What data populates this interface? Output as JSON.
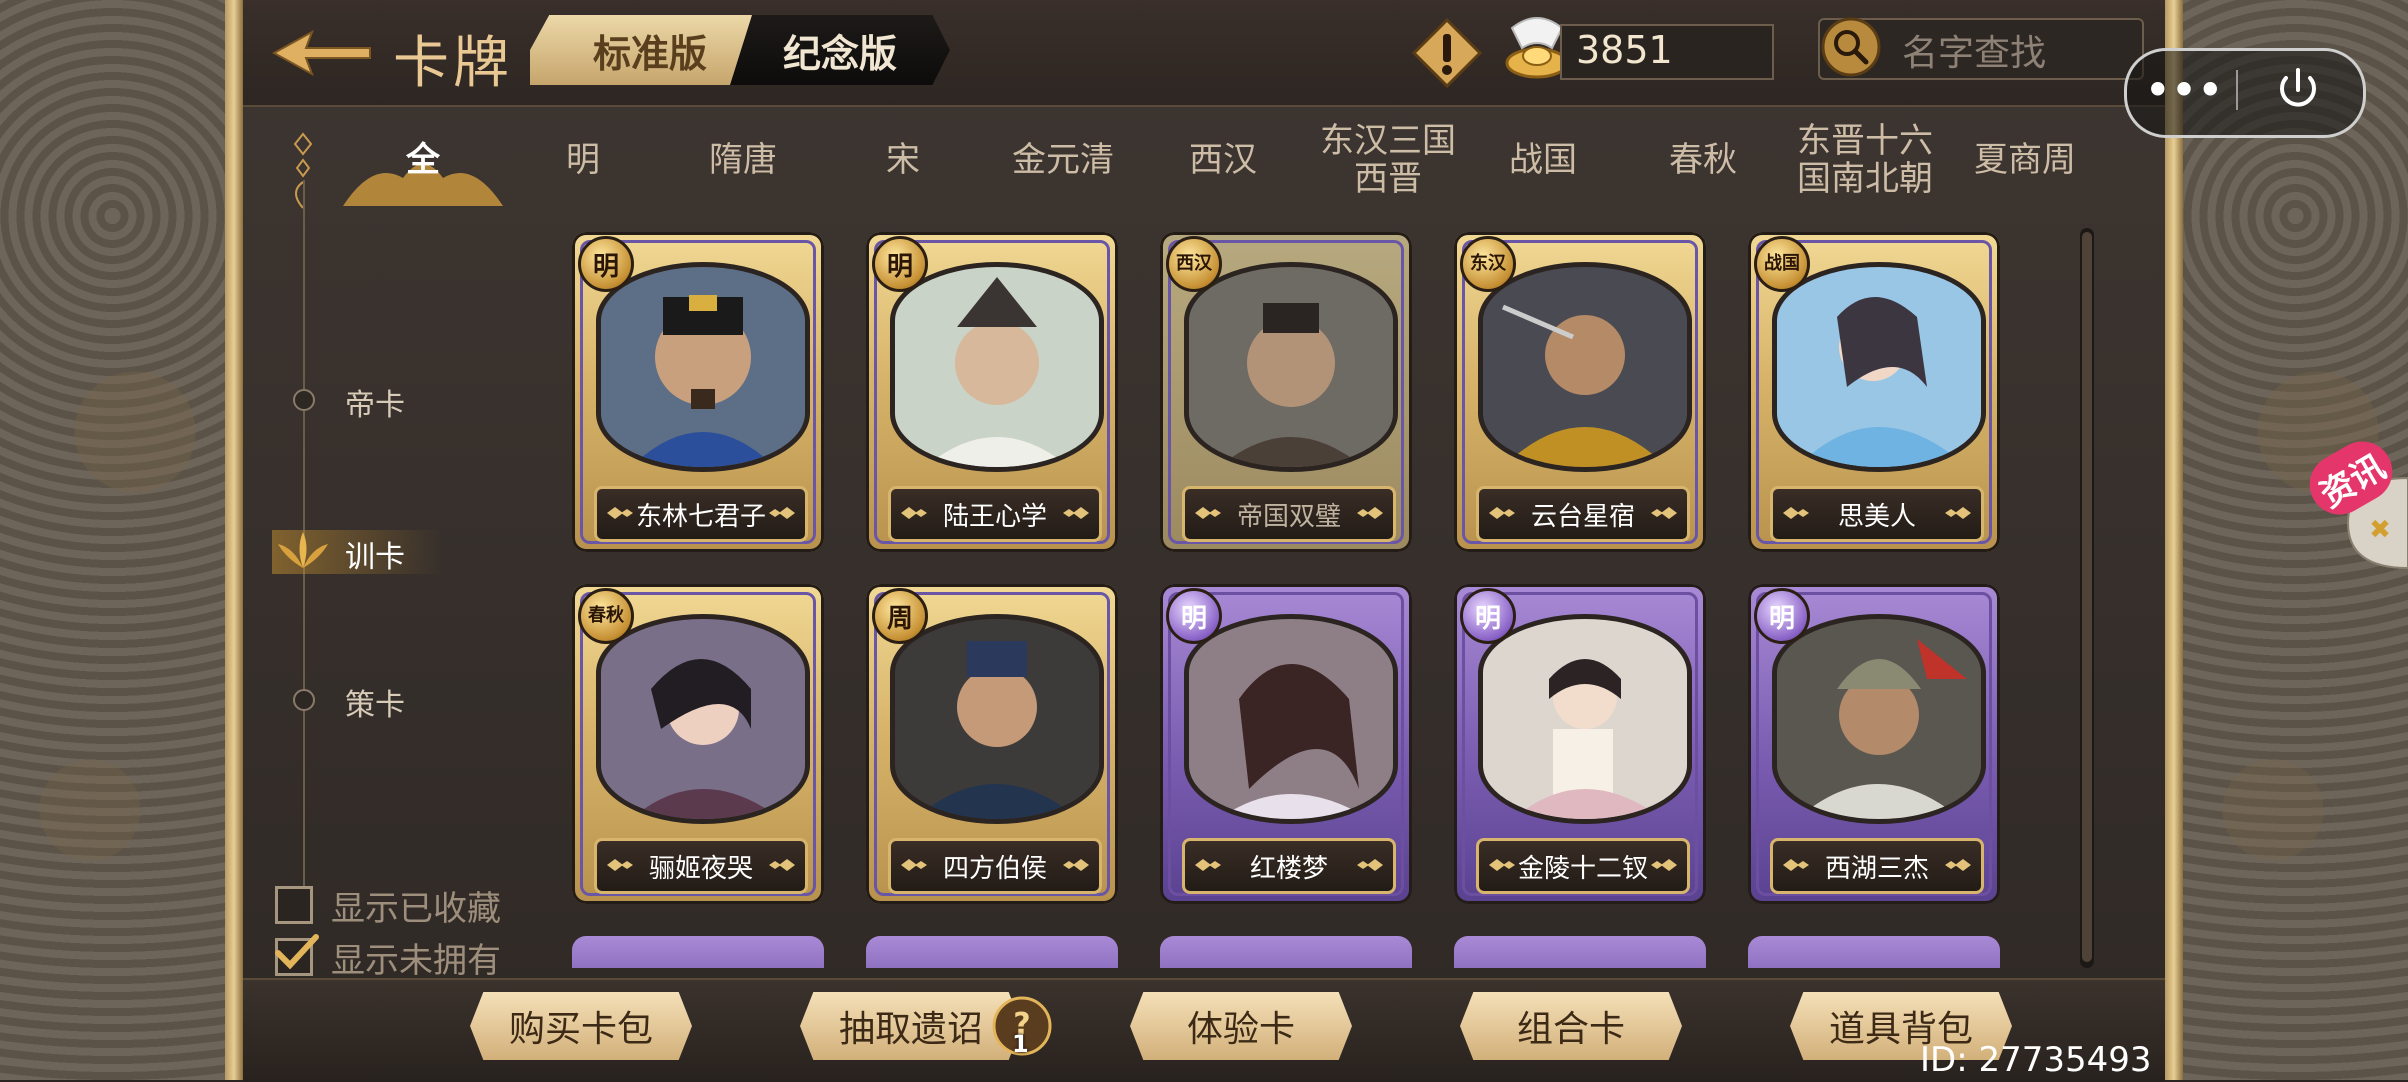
{
  "header": {
    "title": "卡牌",
    "tabs": [
      {
        "label": "标准版",
        "active": true
      },
      {
        "label": "纪念版",
        "active": false
      }
    ],
    "gold_amount": "3851",
    "search_placeholder": "名字查找"
  },
  "eras": [
    {
      "label": "全",
      "active": true
    },
    {
      "label": "明"
    },
    {
      "label": "隋唐"
    },
    {
      "label": "宋"
    },
    {
      "label": "金元清"
    },
    {
      "label": "西汉"
    },
    {
      "label": "东汉三国\n西晋"
    },
    {
      "label": "战国"
    },
    {
      "label": "春秋"
    },
    {
      "label": "东晋十六\n国南北朝"
    },
    {
      "label": "夏商周"
    }
  ],
  "categories": [
    {
      "label": "帝卡"
    },
    {
      "label": "训卡",
      "active": true
    },
    {
      "label": "策卡"
    }
  ],
  "filters": [
    {
      "label": "显示已收藏",
      "checked": false
    },
    {
      "label": "显示未拥有",
      "checked": true
    }
  ],
  "cards": [
    {
      "name": "东林七君子",
      "era": "明",
      "style": "gold"
    },
    {
      "name": "陆王心学",
      "era": "明",
      "style": "gold"
    },
    {
      "name": "帝国双璧",
      "era": "西汉",
      "style": "dim"
    },
    {
      "name": "云台星宿",
      "era": "东汉",
      "style": "gold"
    },
    {
      "name": "思美人",
      "era": "战国",
      "style": "gold"
    },
    {
      "name": "骊姬夜哭",
      "era": "春秋",
      "style": "gold"
    },
    {
      "name": "四方伯侯",
      "era": "周",
      "style": "gold"
    },
    {
      "name": "红楼梦",
      "era": "明",
      "style": "purple"
    },
    {
      "name": "金陵十二钗",
      "era": "明",
      "style": "purple"
    },
    {
      "name": "西湖三杰",
      "era": "明",
      "style": "purple"
    }
  ],
  "actions": [
    {
      "label": "购买卡包"
    },
    {
      "label": "抽取遗诏",
      "badge": "1"
    },
    {
      "label": "体验卡"
    },
    {
      "label": "组合卡"
    },
    {
      "label": "道具背包"
    }
  ],
  "footer": {
    "user_id": "ID: 27735493"
  },
  "side_tab": {
    "label": "资讯"
  },
  "colors": {
    "accent": "#e9c893",
    "gold_card": "#d8b46a",
    "purple_card": "#7a5cb0",
    "news": "#e4366a"
  }
}
